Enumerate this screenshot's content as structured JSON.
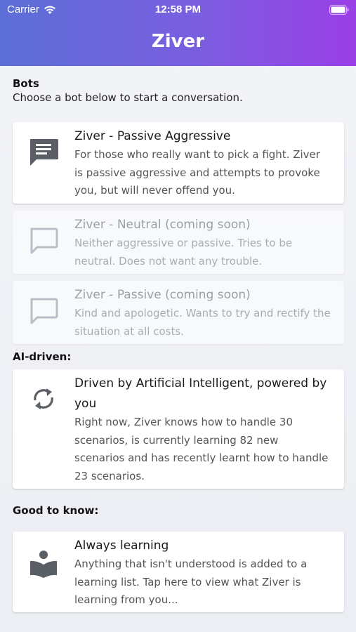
{
  "status_bar": {
    "carrier": "Carrier",
    "time": "12:58 PM"
  },
  "header": {
    "title": "Ziver"
  },
  "bots_section": {
    "title": "Bots",
    "subtitle": "Choose a bot below to start a conversation.",
    "cards": [
      {
        "title": "Ziver - Passive Aggressive",
        "description": "For those who really want to pick a fight. Ziver is passive aggressive and attempts to provoke you, but will never offend you.",
        "icon": "chat-filled-icon"
      },
      {
        "title": "Ziver - Neutral (coming soon)",
        "description": "Neither aggressive or passive. Tries to be neutral. Does not want any trouble.",
        "icon": "chat-outline-icon"
      },
      {
        "title": "Ziver - Passive (coming soon)",
        "description": "Kind and apologetic. Wants to try and rectify the situation at all costs.",
        "icon": "chat-outline-icon"
      }
    ]
  },
  "ai_section": {
    "title": "AI-driven:",
    "card": {
      "title": "Driven by Artificial Intelligent, powered by you",
      "description": "Right now, Ziver knows how to handle 30 scenarios, is currently learning 82 new scenarios and has recently learnt how to handle 23 scenarios.",
      "icon": "sync-icon"
    }
  },
  "info_section": {
    "title": "Good to know:",
    "card": {
      "title": "Always learning",
      "description": "Anything that isn't understood is added to a learning list. Tap here to view what Ziver is learning from you...",
      "icon": "reading-person-icon"
    }
  },
  "colors": {
    "header_start": "#5b6fd6",
    "header_end": "#9a3fe6",
    "icon": "#5a5f66",
    "icon_disabled": "#b9bec6"
  }
}
